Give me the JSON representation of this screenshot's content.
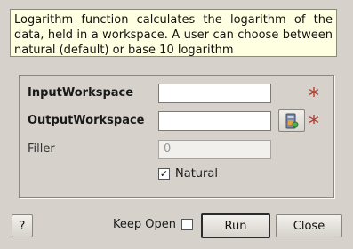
{
  "description": "Logarithm function calculates the logarithm of the data, held in a workspace. A user can choose between natural (default) or base 10 logarithm",
  "fields": {
    "input_workspace": {
      "label": "InputWorkspace",
      "value": "",
      "required_mark": "*"
    },
    "output_workspace": {
      "label": "OutputWorkspace",
      "value": "",
      "required_mark": "*"
    },
    "filler": {
      "label": "Filler",
      "placeholder": "0"
    }
  },
  "natural": {
    "label": "Natural",
    "checked": true,
    "check_glyph": "✓"
  },
  "footer": {
    "help_label": "?",
    "keep_open_label": "Keep Open",
    "keep_open_checked": false,
    "run_label": "Run",
    "close_label": "Close"
  },
  "colors": {
    "required": "#b03a2e",
    "description_bg": "#ffffe1",
    "dialog_bg": "#d6d2cb"
  },
  "icons": {
    "browse": "workspace-browse-icon"
  }
}
